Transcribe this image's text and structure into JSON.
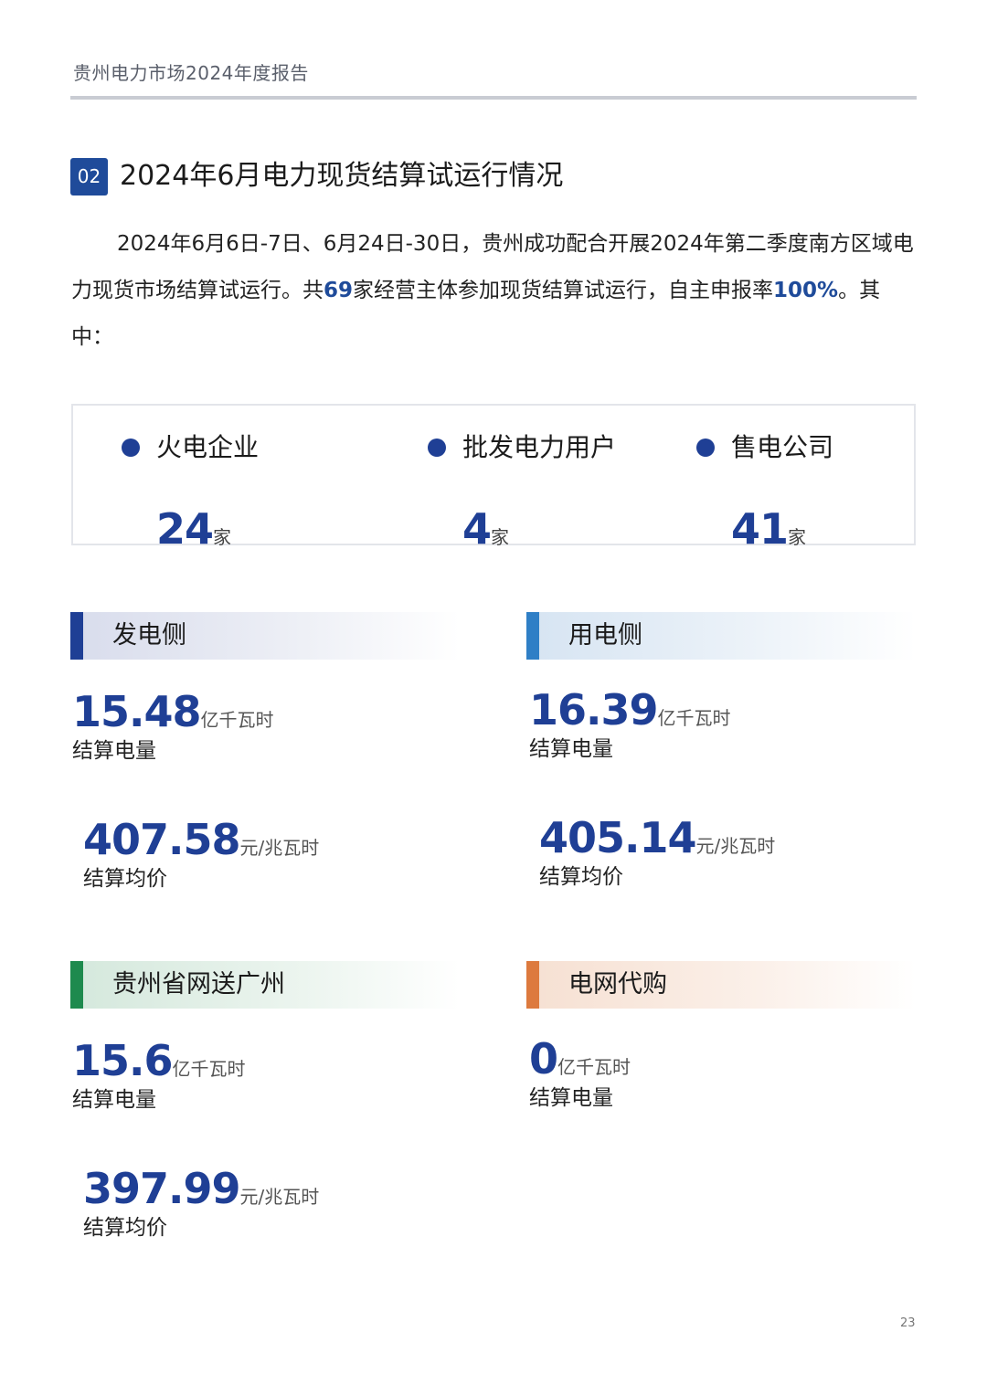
{
  "header": {
    "title": "贵州电力市场2024年度报告"
  },
  "section": {
    "number": "02",
    "title": "2024年6月电力现货结算试运行情况"
  },
  "intro": {
    "part1": "2024年6月6日-7日、6月24日-30日，贵州成功配合开展2024年第二季度南方区域电力现货市场结算试运行。共",
    "count": "69",
    "part2": "家经营主体参加现货结算试运行，自主申报率",
    "rate": "100%",
    "part3": "。其中："
  },
  "summary": [
    {
      "label": "火电企业",
      "value": "24",
      "unit": "家"
    },
    {
      "label": "批发电力用户",
      "value": "4",
      "unit": "家"
    },
    {
      "label": "售电公司",
      "value": "41",
      "unit": "家"
    }
  ],
  "categories": {
    "generation": {
      "name": "发电侧",
      "color": "#1f3f95",
      "volume": {
        "value": "15.48",
        "unit": "亿千瓦时",
        "label": "结算电量"
      },
      "price": {
        "value": "407.58",
        "unit": "元/兆瓦时",
        "label": "结算均价"
      }
    },
    "consumption": {
      "name": "用电侧",
      "color": "#2f7fc6",
      "volume": {
        "value": "16.39",
        "unit": "亿千瓦时",
        "label": "结算电量"
      },
      "price": {
        "value": "405.14",
        "unit": "元/兆瓦时",
        "label": "结算均价"
      }
    },
    "guangzhou": {
      "name": "贵州省网送广州",
      "color": "#1e8a4e",
      "volume": {
        "value": "15.6",
        "unit": "亿千瓦时",
        "label": "结算电量"
      },
      "price": {
        "value": "397.99",
        "unit": "元/兆瓦时",
        "label": "结算均价"
      }
    },
    "agency": {
      "name": "电网代购",
      "color": "#dd7a3e",
      "volume": {
        "value": "0",
        "unit": "亿千瓦时",
        "label": "结算电量"
      }
    }
  },
  "page_number": "23"
}
